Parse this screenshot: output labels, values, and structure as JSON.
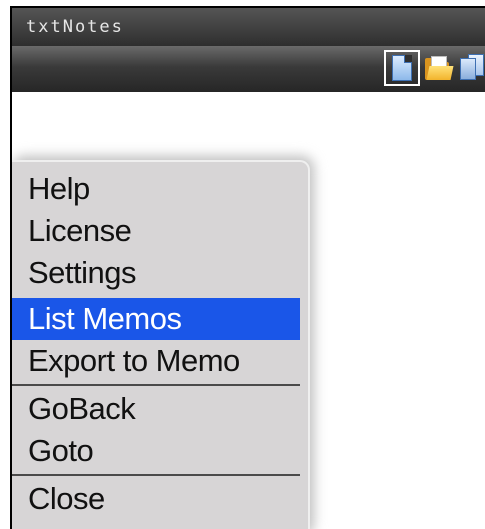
{
  "app": {
    "title": "txtNotes"
  },
  "toolbar": {
    "icons": [
      {
        "name": "new-document-icon",
        "selected": true
      },
      {
        "name": "open-folder-icon",
        "selected": false
      },
      {
        "name": "save-as-icon",
        "selected": false
      }
    ]
  },
  "menu": {
    "groups": [
      [
        "Help",
        "License",
        "Settings"
      ],
      [
        "List Memos",
        "Export to Memo"
      ],
      [
        "GoBack",
        "Goto"
      ],
      [
        "Close"
      ]
    ],
    "items": {
      "help": "Help",
      "license": "License",
      "settings": "Settings",
      "list_memos": "List Memos",
      "export_to_memo": "Export to Memo",
      "goback": "GoBack",
      "goto": "Goto",
      "close": "Close"
    },
    "selected": "List Memos"
  },
  "colors": {
    "titlebar": "#3a3a3a",
    "menu_bg": "#d7d5d6",
    "selection": "#1a56e8",
    "selection_text": "#ffffff",
    "menu_text": "#111111"
  }
}
